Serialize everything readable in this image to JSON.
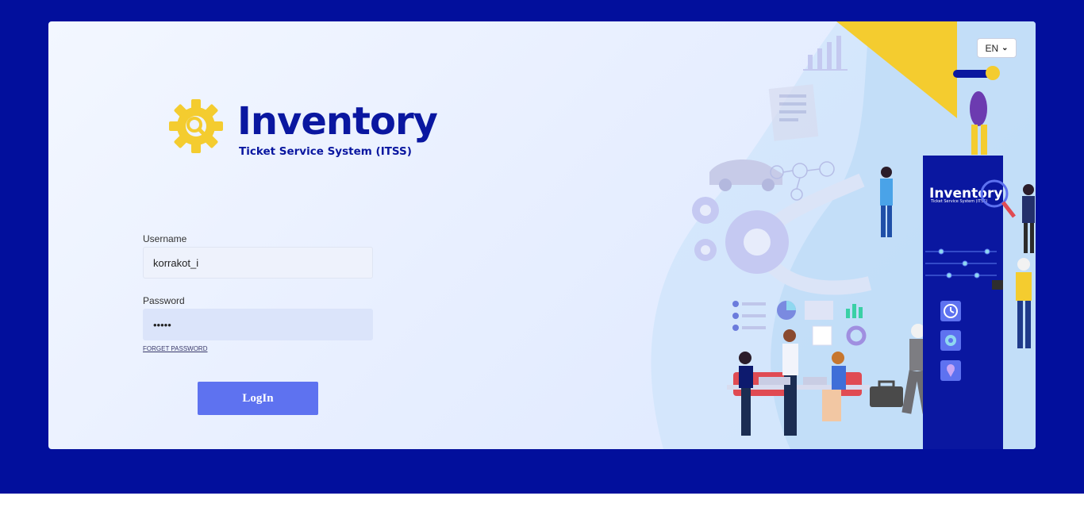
{
  "app": {
    "logo_title": "Inventory",
    "logo_subtitle": "Ticket Service System (ITSS)"
  },
  "language": {
    "selected": "EN"
  },
  "form": {
    "username_label": "Username",
    "username_value": "korrakot_i",
    "password_label": "Password",
    "password_value": "•••••",
    "forget_label": "FORGET PASSWORD",
    "login_label": "LogIn"
  },
  "illustration": {
    "pillar_title": "Inventory",
    "pillar_subtitle": "Ticket Service System (ITSS)"
  },
  "colors": {
    "background": "#020f9c",
    "brand": "#0a17a0",
    "accent_yellow": "#f4cc2f",
    "button": "#5e72f0"
  }
}
